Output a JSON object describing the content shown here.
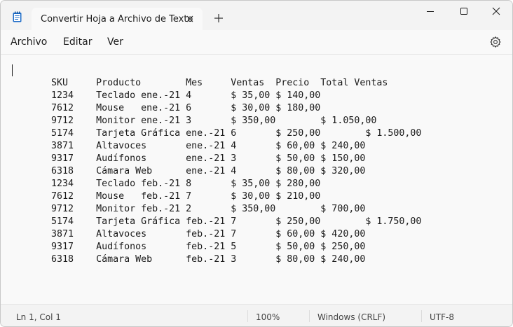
{
  "app": {
    "tab_title": "Convertir Hoja a Archivo de Texto"
  },
  "menu": {
    "file": "Archivo",
    "edit": "Editar",
    "view": "Ver"
  },
  "editor": {
    "lines": [
      "",
      "       SKU     Producto        Mes     Ventas  Precio  Total Ventas",
      "       1234    Teclado ene.-21 4       $ 35,00 $ 140,00",
      "       7612    Mouse   ene.-21 6       $ 30,00 $ 180,00",
      "       9712    Monitor ene.-21 3       $ 350,00        $ 1.050,00",
      "       5174    Tarjeta Gráfica ene.-21 6       $ 250,00        $ 1.500,00",
      "       3871    Altavoces       ene.-21 4       $ 60,00 $ 240,00",
      "       9317    Audífonos       ene.-21 3       $ 50,00 $ 150,00",
      "       6318    Cámara Web      ene.-21 4       $ 80,00 $ 320,00",
      "       1234    Teclado feb.-21 8       $ 35,00 $ 280,00",
      "       7612    Mouse   feb.-21 7       $ 30,00 $ 210,00",
      "       9712    Monitor feb.-21 2       $ 350,00        $ 700,00",
      "       5174    Tarjeta Gráfica feb.-21 7       $ 250,00        $ 1.750,00",
      "       3871    Altavoces       feb.-21 7       $ 60,00 $ 420,00",
      "       9317    Audífonos       feb.-21 5       $ 50,00 $ 250,00",
      "       6318    Cámara Web      feb.-21 3       $ 80,00 $ 240,00"
    ]
  },
  "status": {
    "position": "Ln 1, Col 1",
    "zoom": "100%",
    "line_ending": "Windows (CRLF)",
    "encoding": "UTF-8"
  },
  "icons": {
    "app": "notepad-icon",
    "tab_close": "close-icon",
    "new_tab": "plus-icon",
    "minimize": "minimize-icon",
    "maximize": "maximize-icon",
    "close": "close-icon",
    "settings": "gear-icon"
  },
  "colors": {
    "accent": "#1e6cc8",
    "text": "#1a1a1a",
    "background": "#f9f9f9"
  }
}
